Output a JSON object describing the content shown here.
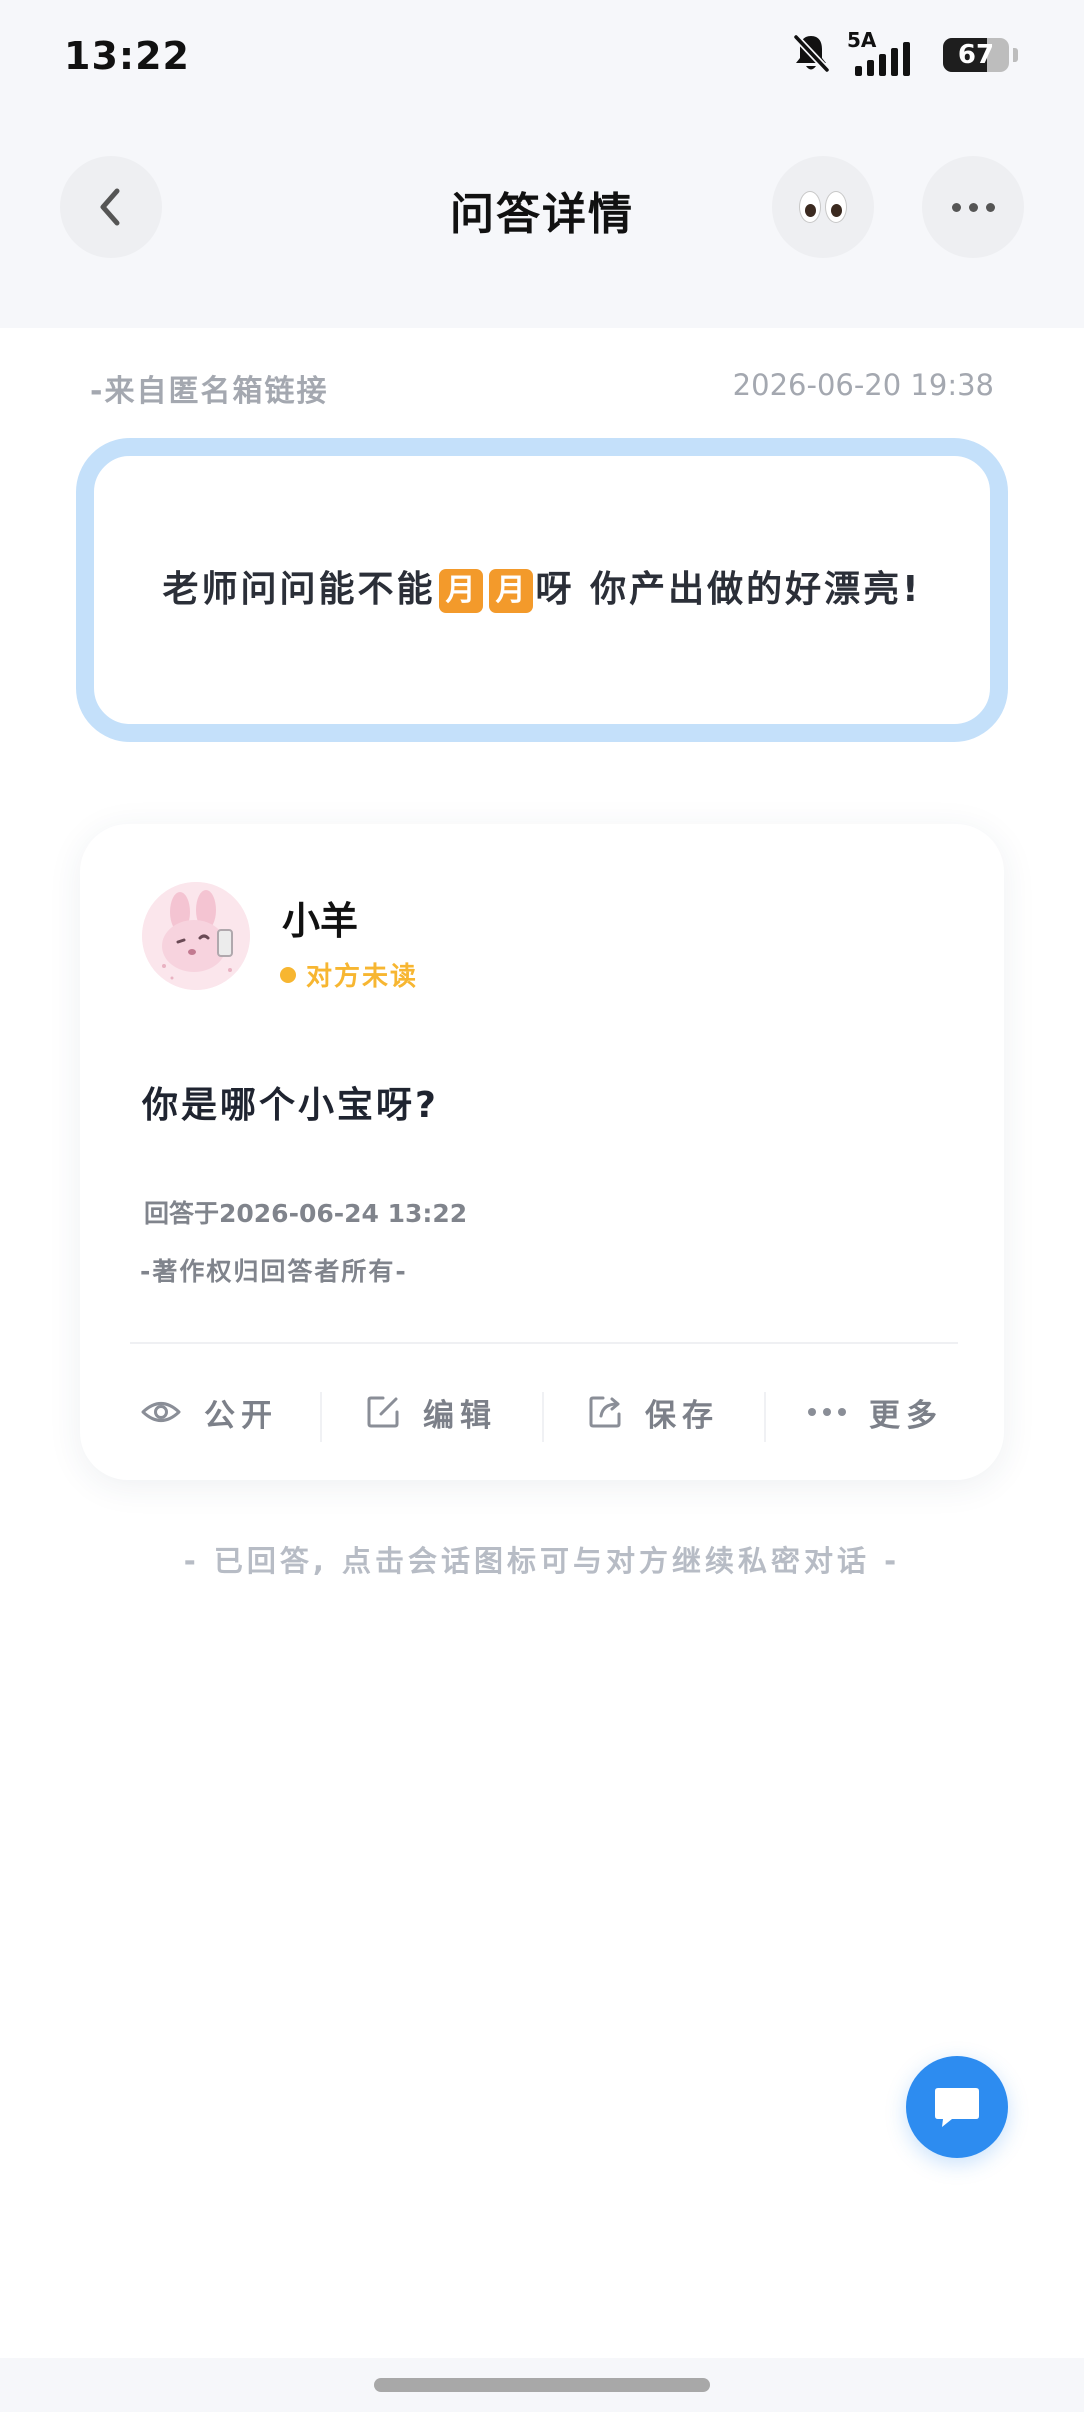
{
  "status_bar": {
    "time": "13:22",
    "signal_label": "5A",
    "battery": "67"
  },
  "nav": {
    "title": "问答详情"
  },
  "question": {
    "source": "-来自匿名箱链接",
    "datetime": "2026-06-20  19:38",
    "text_before": "老师问问能不能",
    "emoji_1": "月",
    "emoji_2": "月",
    "text_after": "呀 你产出做的好漂亮!"
  },
  "answer": {
    "name": "小羊",
    "read_status": "对方未读",
    "text": "你是哪个小宝呀?",
    "answered_at": "回答于2026-06-24 13:22",
    "copyright": "-著作权归回答者所有-"
  },
  "actions": [
    {
      "label": "公开",
      "icon": "eye-icon"
    },
    {
      "label": "编辑",
      "icon": "edit-icon"
    },
    {
      "label": "保存",
      "icon": "share-icon"
    },
    {
      "label": "更多",
      "icon": "more-icon"
    }
  ],
  "footer_note": "- 已回答, 点击会话图标可与对方继续私密对话 -",
  "colors": {
    "accent_blue": "#2d8cf0",
    "card_border": "#c4e0fa",
    "unread_yellow": "#f7b631",
    "moon_emoji": "#f39a2b"
  }
}
